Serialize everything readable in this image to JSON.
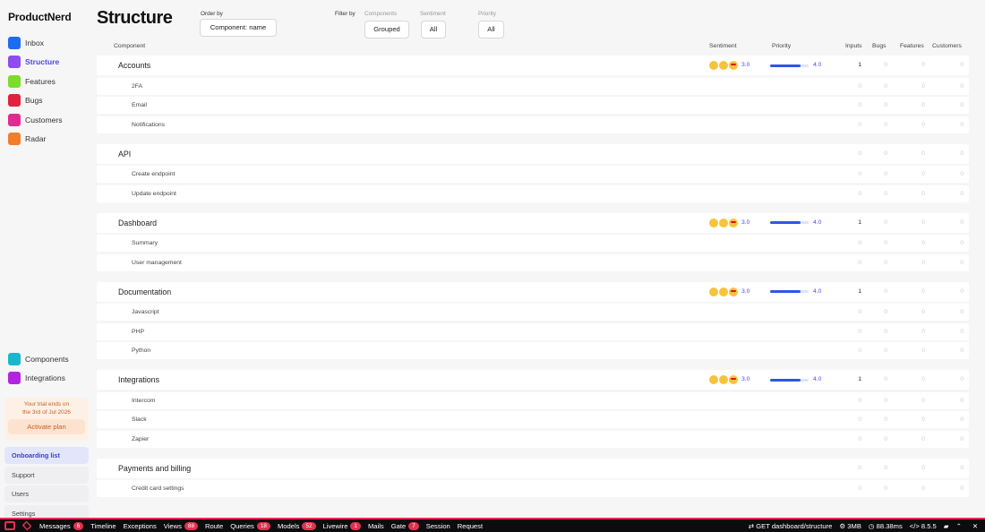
{
  "brand": "ProductNerd",
  "page_title": "Structure",
  "nav": [
    {
      "label": "Inbox",
      "color": "#1d6cf2",
      "active": false
    },
    {
      "label": "Structure",
      "color": "#8b4cf0",
      "active": true
    },
    {
      "label": "Features",
      "color": "#7ddc2a",
      "active": false
    },
    {
      "label": "Bugs",
      "color": "#e0223f",
      "active": false
    },
    {
      "label": "Customers",
      "color": "#e22a8f",
      "active": false
    },
    {
      "label": "Radar",
      "color": "#f27d2b",
      "active": false
    }
  ],
  "nav_bottom": [
    {
      "label": "Components",
      "color": "#1ab7cc"
    },
    {
      "label": "Integrations",
      "color": "#b324e0"
    }
  ],
  "trial": {
    "line1": "Your trial ends on",
    "line2": "the 3rd of Jul 2026",
    "button": "Activate plan"
  },
  "side_links": [
    {
      "label": "Onboarding list",
      "active": true
    },
    {
      "label": "Support",
      "active": false
    },
    {
      "label": "Users",
      "active": false
    },
    {
      "label": "Settings",
      "active": false
    }
  ],
  "filters": {
    "order_by_label": "Order by",
    "order_by_value": "Component: name",
    "filter_by_label": "Filter by",
    "components_label": "Components",
    "components_value": "Grouped",
    "sentiment_label": "Sentiment",
    "sentiment_value": "All",
    "priority_label": "Priority",
    "priority_value": "All"
  },
  "columns": {
    "component": "Component",
    "sentiment": "Sentiment",
    "priority": "Priority",
    "inputs": "Inputs",
    "bugs": "Bugs",
    "features": "Features",
    "customers": "Customers"
  },
  "groups": [
    {
      "name": "Accounts",
      "sentiment": "3.0",
      "priority": "4.0",
      "priority_fraction": 0.8,
      "inputs": "1",
      "bugs": "0",
      "features": "0",
      "customers": "0",
      "children": [
        {
          "name": "2FA"
        },
        {
          "name": "Email"
        },
        {
          "name": "Notifications"
        }
      ]
    },
    {
      "name": "API",
      "sentiment": "",
      "priority": "",
      "inputs": "0",
      "bugs": "0",
      "features": "0",
      "customers": "0",
      "children": [
        {
          "name": "Create endpoint"
        },
        {
          "name": "Update endpoint"
        }
      ]
    },
    {
      "name": "Dashboard",
      "sentiment": "3.0",
      "priority": "4.0",
      "priority_fraction": 0.8,
      "inputs": "1",
      "bugs": "0",
      "features": "0",
      "customers": "0",
      "children": [
        {
          "name": "Summary"
        },
        {
          "name": "User management"
        }
      ]
    },
    {
      "name": "Documentation",
      "sentiment": "3.0",
      "priority": "4.0",
      "priority_fraction": 0.8,
      "inputs": "1",
      "bugs": "0",
      "features": "0",
      "customers": "0",
      "children": [
        {
          "name": "Javascript"
        },
        {
          "name": "PHP"
        },
        {
          "name": "Python"
        }
      ]
    },
    {
      "name": "Integrations",
      "sentiment": "3.0",
      "priority": "4.0",
      "priority_fraction": 0.8,
      "inputs": "1",
      "bugs": "0",
      "features": "0",
      "customers": "0",
      "children": [
        {
          "name": "Intercom"
        },
        {
          "name": "Slack"
        },
        {
          "name": "Zapier"
        }
      ]
    },
    {
      "name": "Payments and billing",
      "sentiment": "",
      "priority": "",
      "inputs": "0",
      "bugs": "0",
      "features": "0",
      "customers": "0",
      "children": [
        {
          "name": "Credit card settings"
        }
      ]
    }
  ],
  "debugbar": {
    "tabs": [
      {
        "label": "Messages",
        "badge": "6"
      },
      {
        "label": "Timeline",
        "badge": ""
      },
      {
        "label": "Exceptions",
        "badge": ""
      },
      {
        "label": "Views",
        "badge": "88"
      },
      {
        "label": "Route",
        "badge": ""
      },
      {
        "label": "Queries",
        "badge": "18"
      },
      {
        "label": "Models",
        "badge": "52"
      },
      {
        "label": "Livewire",
        "badge": "1"
      },
      {
        "label": "Mails",
        "badge": ""
      },
      {
        "label": "Gate",
        "badge": "7"
      },
      {
        "label": "Session",
        "badge": ""
      },
      {
        "label": "Request",
        "badge": ""
      }
    ],
    "route": "GET dashboard/structure",
    "memory": "3MB",
    "time": "88.38ms",
    "php": "8.5.5"
  }
}
